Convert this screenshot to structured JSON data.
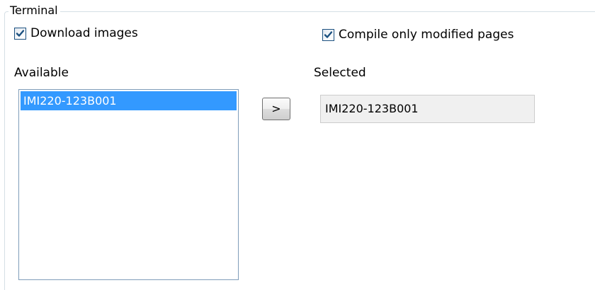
{
  "group": {
    "title": "Terminal"
  },
  "options": {
    "download_images": {
      "label": "Download images",
      "checked": true
    },
    "compile_only_modified": {
      "label": "Compile only modified pages",
      "checked": true
    }
  },
  "available": {
    "label": "Available",
    "items": [
      "IMI220-123B001"
    ],
    "selected_index": 0
  },
  "move_button": {
    "label": ">"
  },
  "selected": {
    "label": "Selected",
    "value": "IMI220-123B001"
  },
  "colors": {
    "selection_bg": "#3399ff",
    "selection_text": "#ffffff",
    "checkmark": "#1c5180",
    "listbox_border": "#7f9db9",
    "groupbox_border": "#d5dfe5",
    "readonly_bg": "#f0f0f0"
  }
}
